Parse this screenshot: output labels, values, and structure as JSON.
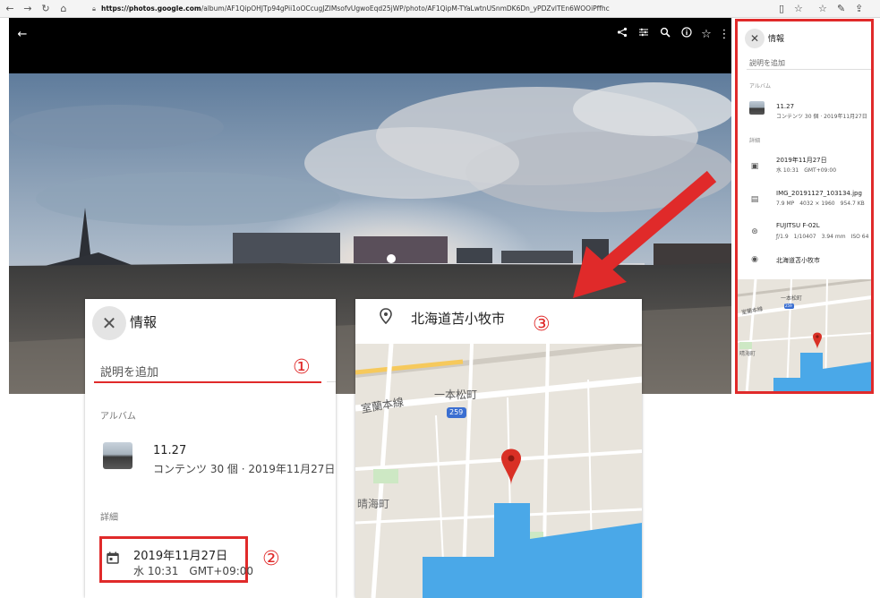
{
  "browser": {
    "back": "←",
    "forward": "→",
    "reload": "↻",
    "home": "⌂",
    "url_host": "https://photos.google.com",
    "url_path": "/album/AF1QipOHJTp94gPii1oOCcugJZIMsofvUgwoEqd25jWP/photo/AF1QipM-TYaLwtnUSnmDK6Dn_yPDZvlTEn6WOOiPffhc"
  },
  "viewer": {
    "back_icon": "←",
    "icons": [
      "share-icon",
      "tune-icon",
      "zoom-icon",
      "info-icon",
      "star-icon",
      "more-icon"
    ]
  },
  "info_panel_small": {
    "title": "情報",
    "description_placeholder": "説明を追加",
    "album_section": "アルバム",
    "album_name": "11.27",
    "album_meta": "コンテンツ 30 個 · 2019年11月27日",
    "details_section": "詳細",
    "date": "2019年11月27日",
    "time": "水 10:31　GMT+09:00",
    "file_name": "IMG_20191127_103134.jpg",
    "file_meta": "7.9 MP　4032 × 1960　954.7 KB",
    "camera": "FUJITSU F-02L",
    "camera_meta": "ƒ/1.9　1/10407　3.94 mm　ISO 64",
    "location": "北海道苫小牧市",
    "map_label_town": "一本松町",
    "map_label_line": "室蘭本線",
    "map_road_badge": "259",
    "map_label_town2": "晴海町"
  },
  "zoom_info": {
    "title": "情報",
    "description_placeholder": "説明を追加",
    "marker1": "①",
    "album_section": "アルバム",
    "album_name": "11.27",
    "album_meta": "コンテンツ 30 個 · 2019年11月27日",
    "details_section": "詳細",
    "date": "2019年11月27日",
    "time": "水 10:31　GMT+09:00",
    "marker2": "②"
  },
  "zoom_map": {
    "location": "北海道苫小牧市",
    "marker3": "③",
    "map_label_town": "一本松町",
    "map_label_line": "室蘭本線",
    "map_road_badge": "259",
    "map_label_town2": "晴海町"
  },
  "colors": {
    "annotation_red": "#e02a2a",
    "map_water": "#4aa8e8",
    "map_land": "#e8e4dc",
    "pin": "#d93025"
  }
}
